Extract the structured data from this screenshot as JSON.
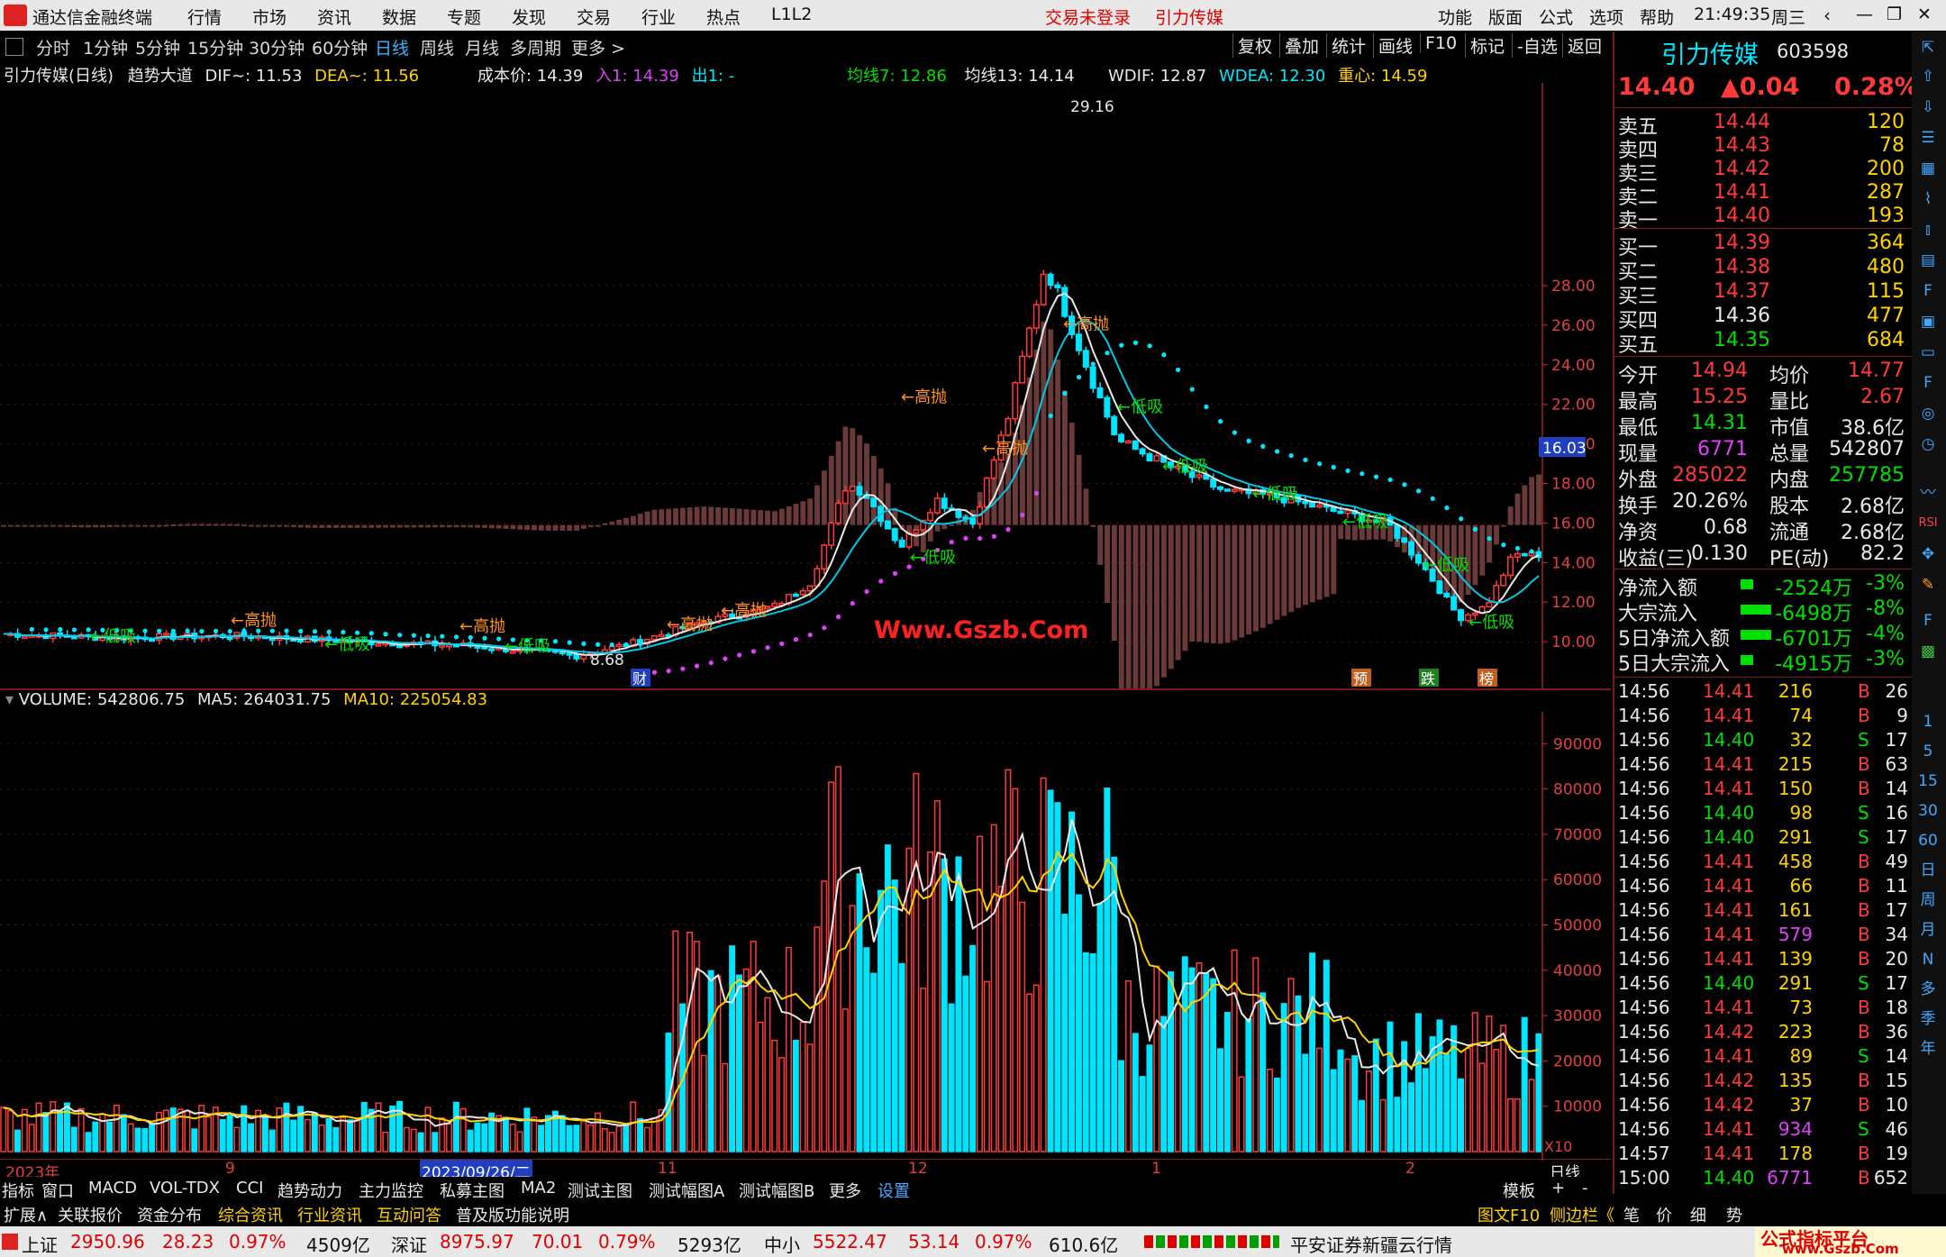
{
  "app_title": "通达信金融终端",
  "menu": [
    "行情",
    "市场",
    "资讯",
    "数据",
    "专题",
    "发现",
    "交易",
    "行业",
    "热点",
    "L1L2"
  ],
  "menu_alerts": [
    "交易未登录",
    "引力传媒"
  ],
  "menu_right": [
    "功能",
    "版面",
    "公式",
    "选项",
    "帮助"
  ],
  "clock": "21:49:35",
  "weekday": "周三",
  "periods": [
    "分时",
    "1分钟",
    "5分钟",
    "15分钟",
    "30分钟",
    "60分钟",
    "日线",
    "周线",
    "月线",
    "多周期",
    "更多 >"
  ],
  "toolbar": [
    "复权",
    "叠加",
    "统计",
    "画线",
    "F10",
    "标记",
    "-自选",
    "返回"
  ],
  "main_info": {
    "title": "引力传媒(日线)",
    "indicator": "趋势大道",
    "dif": "DIF~: 11.53",
    "dea": "DEA~: 11.56",
    "cost": "成本价: 14.39",
    "buy": "入1: 14.39",
    "sell": "出1: -",
    "ma7": "均线7: 12.86",
    "ma13": "均线13: 14.14",
    "wdif": "WDIF: 12.87",
    "wdea": "WDEA: 12.30",
    "center": "重心: 14.59"
  },
  "price_axis": [
    "28.00",
    "26.00",
    "24.00",
    "22.00",
    "20.00",
    "18.00",
    "16.00",
    "14.00",
    "12.00",
    "10.00"
  ],
  "price_marker": "16.03",
  "peak_label": "29.16",
  "low_label": "8.68",
  "watermark": "Www.Gszb.Com",
  "signals": [
    "←低吸",
    "←高抛"
  ],
  "event_tags": [
    "财",
    "预",
    "跌",
    "榜"
  ],
  "vol_info": {
    "volume": "VOLUME: 542806.75",
    "ma5": "MA5: 264031.75",
    "ma10": "MA10: 225054.83"
  },
  "vol_axis": [
    "90000",
    "80000",
    "70000",
    "60000",
    "50000",
    "40000",
    "30000",
    "20000",
    "10000"
  ],
  "vol_unit": "X10",
  "date_axis": [
    "2023年",
    "9",
    "2023/09/26/二",
    "11",
    "12",
    "1",
    "2"
  ],
  "period_tag": "日线",
  "chart_data": {
    "type": "candlestick",
    "ylim": [
      8.0,
      30.0
    ],
    "peak": 29.16,
    "low": 8.68,
    "volume_ylim": [
      0,
      100000
    ]
  },
  "quote": {
    "name": "引力传媒",
    "code": "603598",
    "price": "14.40",
    "change": "▲0.04",
    "pct": "0.28%",
    "asks": [
      {
        "label": "卖五",
        "price": "14.44",
        "vol": "120"
      },
      {
        "label": "卖四",
        "price": "14.43",
        "vol": "78"
      },
      {
        "label": "卖三",
        "price": "14.42",
        "vol": "200"
      },
      {
        "label": "卖二",
        "price": "14.41",
        "vol": "287"
      },
      {
        "label": "卖一",
        "price": "14.40",
        "vol": "193"
      }
    ],
    "bids": [
      {
        "label": "买一",
        "price": "14.39",
        "vol": "364"
      },
      {
        "label": "买二",
        "price": "14.38",
        "vol": "480"
      },
      {
        "label": "买三",
        "price": "14.37",
        "vol": "115"
      },
      {
        "label": "买四",
        "price": "14.36",
        "vol": "477"
      },
      {
        "label": "买五",
        "price": "14.35",
        "vol": "684"
      }
    ],
    "stats": [
      [
        "今开",
        "14.94",
        "均价",
        "14.77"
      ],
      [
        "最高",
        "15.25",
        "量比",
        "2.67"
      ],
      [
        "最低",
        "14.31",
        "市值",
        "38.6亿"
      ],
      [
        "现量",
        "6771",
        "总量",
        "542807"
      ],
      [
        "外盘",
        "285022",
        "内盘",
        "257785"
      ],
      [
        "换手",
        "20.26%",
        "股本",
        "2.68亿"
      ],
      [
        "净资",
        "0.68",
        "流通",
        "2.68亿"
      ],
      [
        "收益(三)",
        "0.130",
        "PE(动)",
        "82.2"
      ]
    ],
    "flows": [
      [
        "净流入额",
        "-2524万",
        "-3%"
      ],
      [
        "大宗流入",
        "-6498万",
        "-8%"
      ],
      [
        "5日净流入额",
        "-6701万",
        "-4%"
      ],
      [
        "5日大宗流入",
        "-4915万",
        "-3%"
      ]
    ],
    "ticks": [
      [
        "14:56",
        "14.41",
        "216",
        "B",
        "26"
      ],
      [
        "14:56",
        "14.41",
        "74",
        "B",
        "9"
      ],
      [
        "14:56",
        "14.40",
        "32",
        "S",
        "17"
      ],
      [
        "14:56",
        "14.41",
        "215",
        "B",
        "63"
      ],
      [
        "14:56",
        "14.41",
        "150",
        "B",
        "14"
      ],
      [
        "14:56",
        "14.40",
        "98",
        "S",
        "16"
      ],
      [
        "14:56",
        "14.40",
        "291",
        "S",
        "17"
      ],
      [
        "14:56",
        "14.41",
        "458",
        "B",
        "49"
      ],
      [
        "14:56",
        "14.41",
        "66",
        "B",
        "11"
      ],
      [
        "14:56",
        "14.41",
        "161",
        "B",
        "17"
      ],
      [
        "14:56",
        "14.41",
        "579",
        "B",
        "34"
      ],
      [
        "14:56",
        "14.41",
        "139",
        "B",
        "20"
      ],
      [
        "14:56",
        "14.40",
        "291",
        "S",
        "17"
      ],
      [
        "14:56",
        "14.41",
        "73",
        "B",
        "18"
      ],
      [
        "14:56",
        "14.42",
        "223",
        "B",
        "36"
      ],
      [
        "14:56",
        "14.41",
        "89",
        "S",
        "14"
      ],
      [
        "14:56",
        "14.42",
        "135",
        "B",
        "15"
      ],
      [
        "14:56",
        "14.42",
        "37",
        "B",
        "10"
      ],
      [
        "14:56",
        "14.41",
        "934",
        "S",
        "46"
      ],
      [
        "14:57",
        "14.41",
        "178",
        "B",
        "19"
      ],
      [
        "15:00",
        "14.40",
        "6771",
        "B",
        "652"
      ]
    ]
  },
  "side_icons": [
    "1",
    "5",
    "15",
    "30",
    "60",
    "日",
    "周",
    "月",
    "N",
    "多",
    "季",
    "年"
  ],
  "tabs_row1": [
    "指标",
    "窗口",
    "MACD",
    "VOL-TDX",
    "CCI",
    "趋势动力",
    "主力监控",
    "私募主图",
    "MA2",
    "测试主图",
    "测试幅图A",
    "测试幅图B",
    "更多",
    "设置"
  ],
  "tabs_row1_right": [
    "模板",
    "+",
    "-"
  ],
  "tabs_row2": [
    "扩展∧",
    "关联报价",
    "资金分布",
    "综合资讯",
    "行业资讯",
    "互动问答",
    "普及版功能说明"
  ],
  "tabs_row2_right": [
    "图文F10",
    "侧边栏《",
    "笔",
    "价",
    "细",
    "势"
  ],
  "status": {
    "sh": "上证",
    "sh_v": "2950.96",
    "sh_c": "28.23",
    "sh_p": "0.97%",
    "sh_a": "4509亿",
    "sz": "深证",
    "sz_v": "8975.97",
    "sz_c": "70.01",
    "sz_p": "0.79%",
    "sz_a": "5293亿",
    "zx": "中小",
    "zx_v": "5522.47",
    "zx_c": "53.14",
    "zx_p": "0.97%",
    "zx_a": "610.6亿",
    "broker": "平安证券新疆云行情",
    "brand": "公式指标平台",
    "brand_url": "www.Gszb.Com"
  }
}
